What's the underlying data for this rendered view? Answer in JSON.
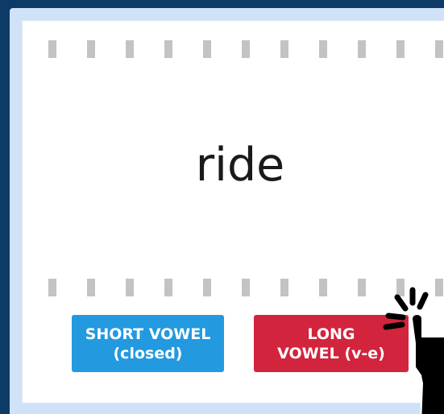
{
  "card": {
    "word": "ride"
  },
  "answers": {
    "short": {
      "line1": "SHORT VOWEL",
      "line2": "(closed)",
      "color": "#2399e0"
    },
    "long": {
      "line1": "LONG",
      "line2": "VOWEL (v-e)",
      "color": "#d2243d"
    }
  },
  "icons": {
    "pointer": "hand-pointer-click-icon"
  },
  "colors": {
    "background": "#0d3a66",
    "frame": "#cfe2f7",
    "card": "#ffffff",
    "dash": "#c3c3c3"
  }
}
